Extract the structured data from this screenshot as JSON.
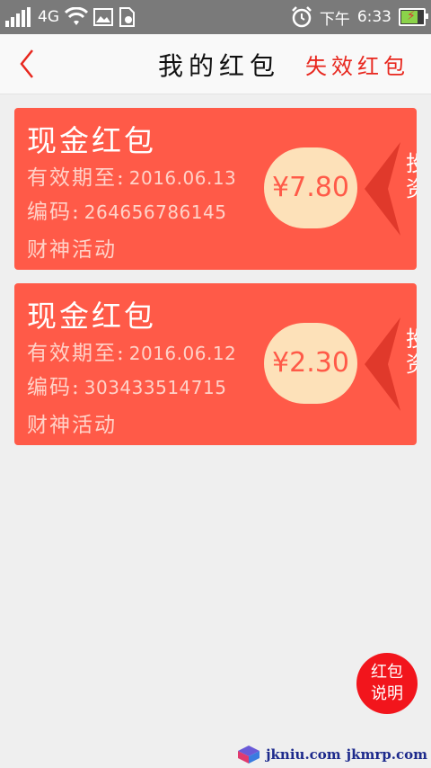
{
  "statusbar": {
    "network": "4G",
    "ampm": "下午",
    "time": "6:33",
    "icons": [
      "signal-icon",
      "wifi-icon",
      "image-icon",
      "file-icon",
      "alarm-icon",
      "battery-charging-icon"
    ]
  },
  "header": {
    "title": "我的红包",
    "expired_link": "失效红包",
    "back_icon": "chevron-left-icon",
    "accent": "#e8271e"
  },
  "cards": [
    {
      "type": "现金红包",
      "expiry_label": "有效期至:",
      "expiry": "2016.06.13",
      "code_label": "编码:",
      "code": "264656786145",
      "source": "财神活动",
      "amount": "¥7.80",
      "side_text": "投资"
    },
    {
      "type": "现金红包",
      "expiry_label": "有效期至:",
      "expiry": "2016.06.12",
      "code_label": "编码:",
      "code": "303433514715",
      "source": "财神活动",
      "amount": "¥2.30",
      "side_text": "投资"
    }
  ],
  "fab": {
    "line1": "红包",
    "line2": "说明"
  },
  "watermark": {
    "text1": "jkniu.com",
    "text2": "jkmrp.com"
  },
  "colors": {
    "card": "#ff5a48",
    "amount_bg": "#fde1b9",
    "fab": "#f2151c"
  }
}
